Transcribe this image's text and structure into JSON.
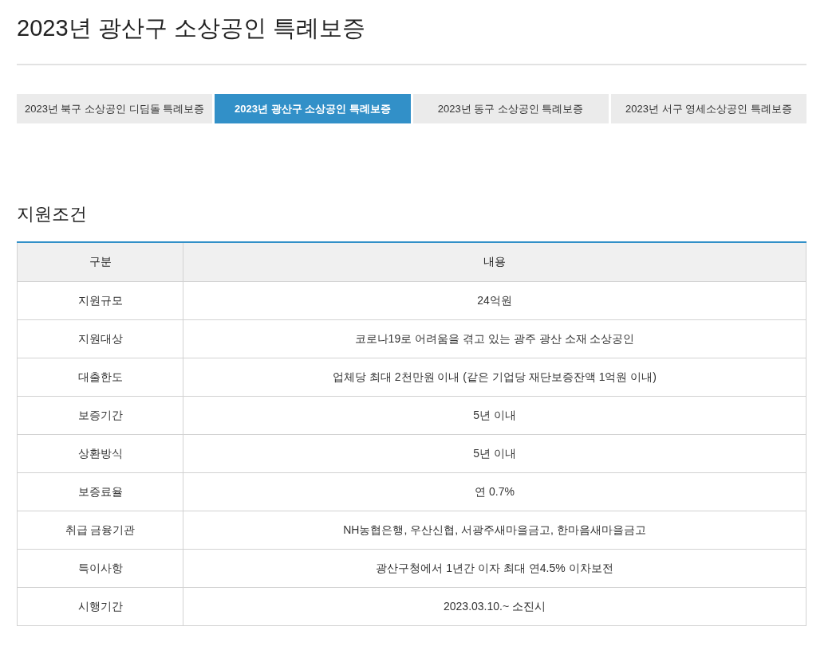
{
  "page_title": "2023년 광산구 소상공인 특례보증",
  "tabs": [
    {
      "label": "2023년 북구 소상공인 디딤돌 특례보증",
      "selected": false
    },
    {
      "label": "2023년 광산구 소상공인 특례보증",
      "selected": true
    },
    {
      "label": "2023년 동구 소상공인 특례보증",
      "selected": false
    },
    {
      "label": "2023년 서구 영세소상공인 특례보증",
      "selected": false
    }
  ],
  "section_title": "지원조건",
  "table": {
    "columns": [
      "구분",
      "내용"
    ],
    "rows": [
      [
        "지원규모",
        "24억원"
      ],
      [
        "지원대상",
        "코로나19로 어려움을 겪고 있는 광주 광산 소재 소상공인"
      ],
      [
        "대출한도",
        "업체당 최대 2천만원 이내 (같은 기업당 재단보증잔액 1억원 이내)"
      ],
      [
        "보증기간",
        "5년 이내"
      ],
      [
        "상환방식",
        "5년 이내"
      ],
      [
        "보증료율",
        "연 0.7%"
      ],
      [
        "취급 금융기관",
        "NH농협은행, 우산신협, 서광주새마을금고, 한마음새마을금고"
      ],
      [
        "특이사항",
        "광산구청에서 1년간 이자 최대 연4.5% 이차보전"
      ],
      [
        "시행기간",
        "2023.03.10.~ 소진시"
      ]
    ]
  }
}
